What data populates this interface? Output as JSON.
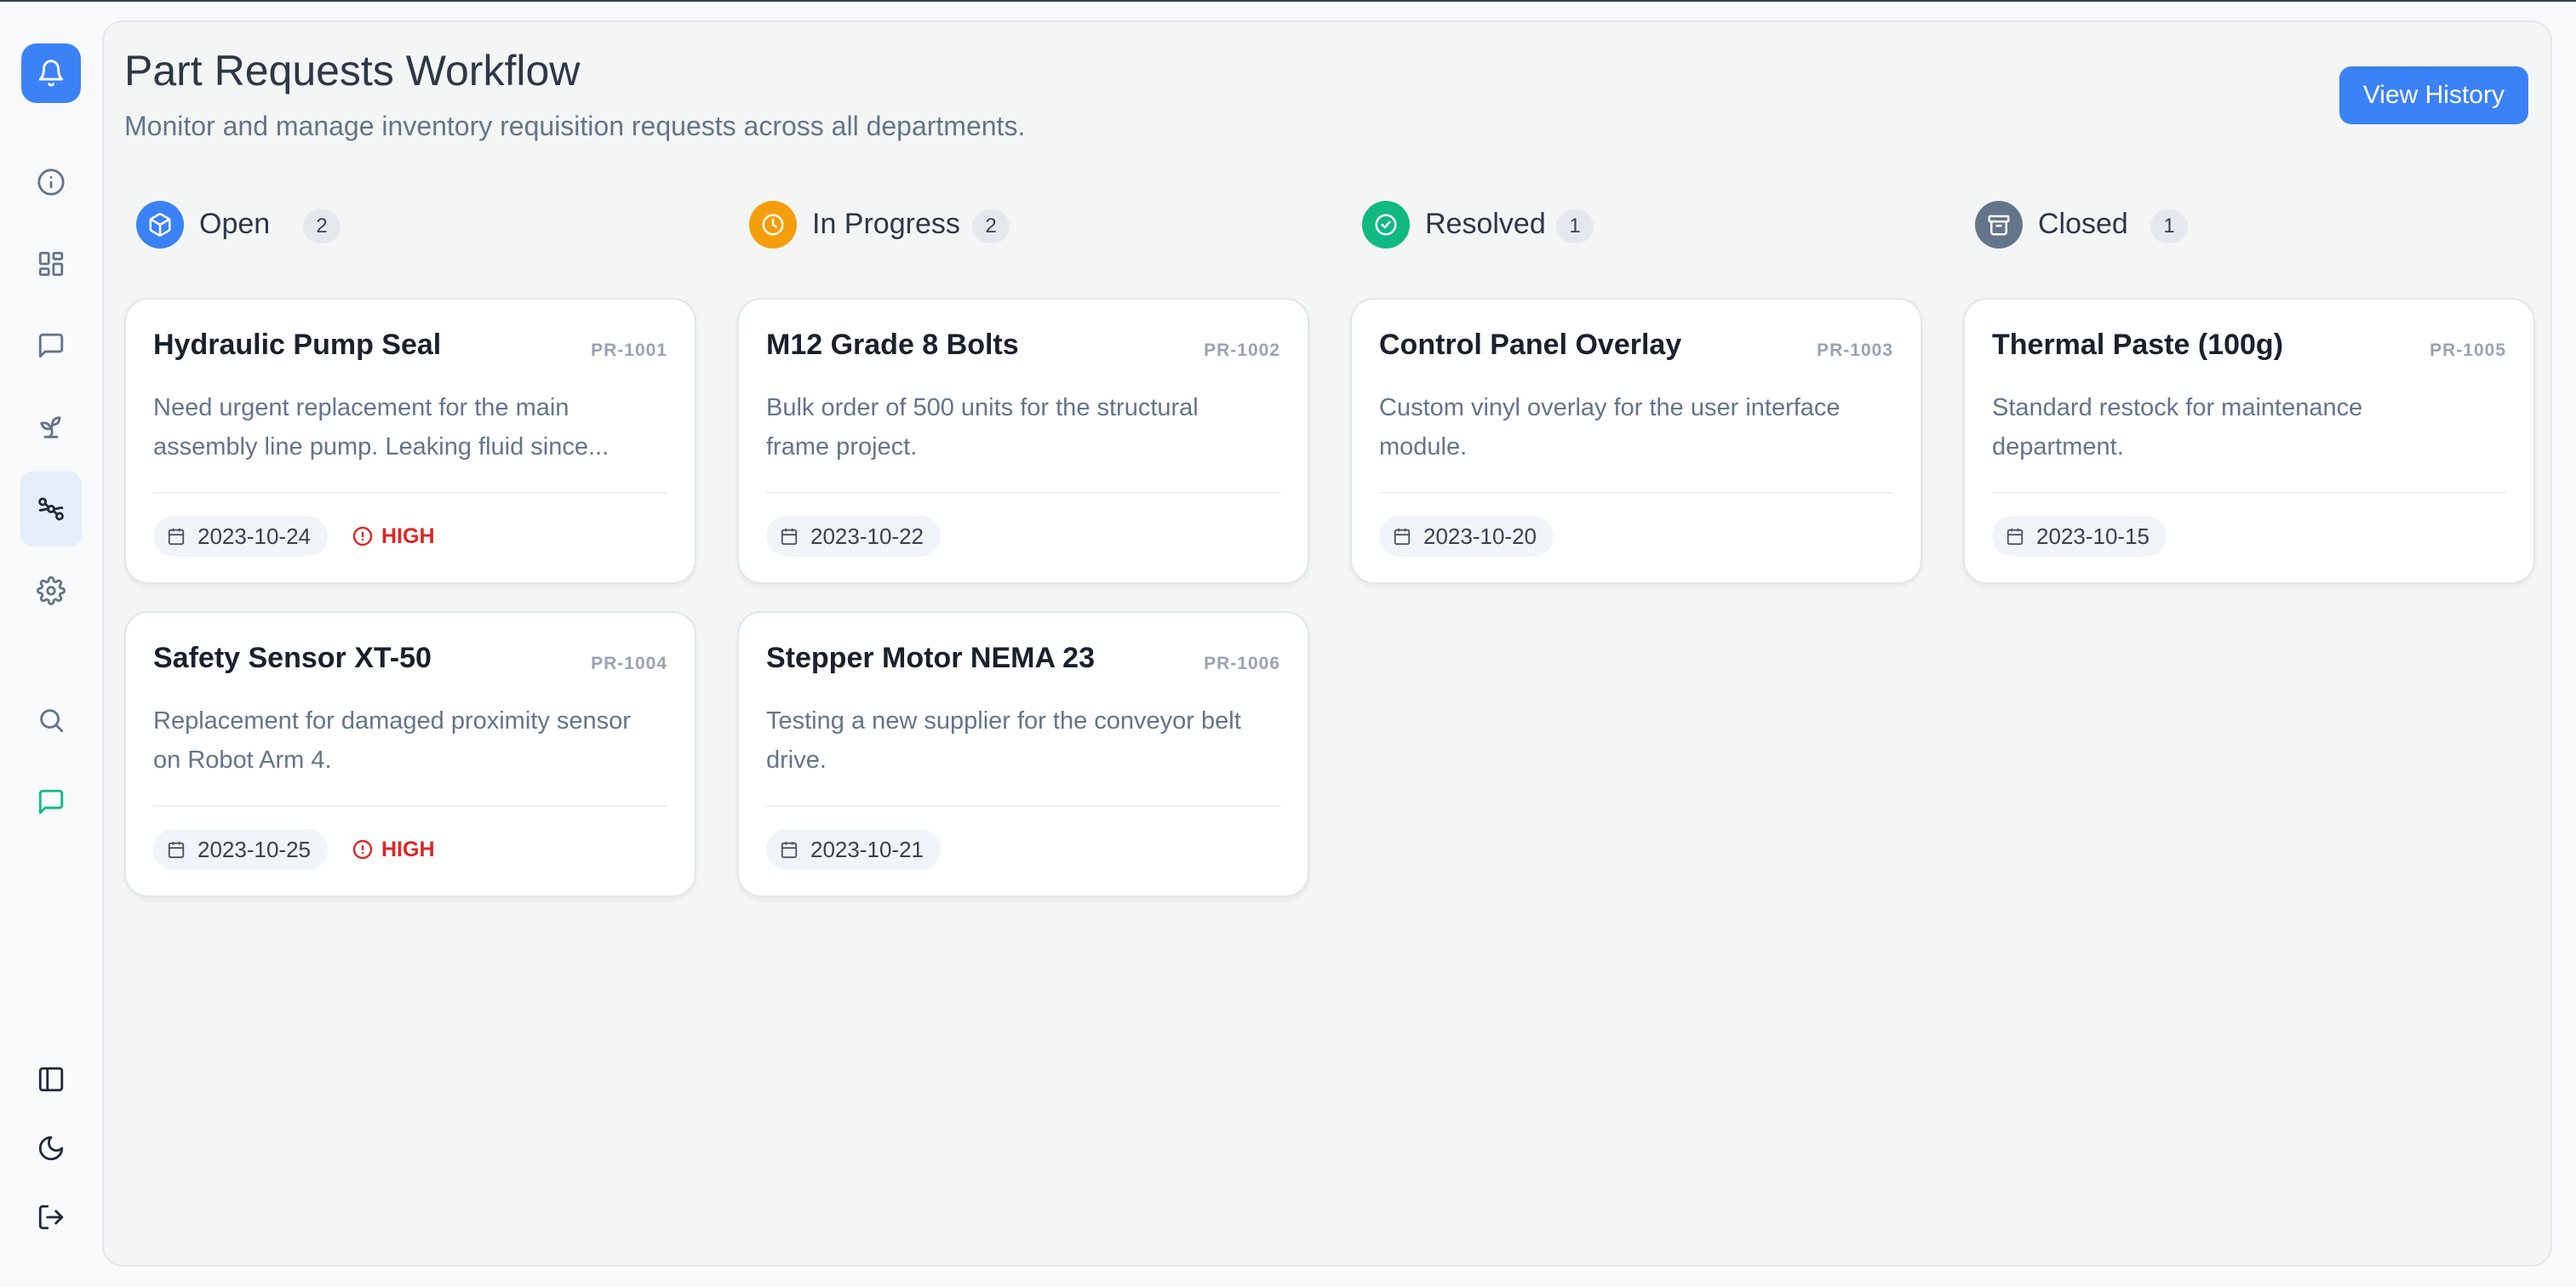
{
  "page": {
    "title": "Part Requests Workflow",
    "subtitle": "Monitor and manage inventory requisition requests across all departments.",
    "history_button": "View History"
  },
  "sidebar": {
    "items": [
      {
        "icon": "bell-icon",
        "active": true
      },
      {
        "icon": "info-icon"
      },
      {
        "icon": "dashboard-icon"
      },
      {
        "icon": "message-icon"
      },
      {
        "icon": "sprout-icon"
      },
      {
        "icon": "workflow-icon",
        "active": true
      },
      {
        "icon": "gear-icon"
      },
      {
        "icon": "search-icon"
      },
      {
        "icon": "chat-icon"
      },
      {
        "icon": "panel-toggle-icon"
      },
      {
        "icon": "moon-icon"
      },
      {
        "icon": "logout-icon"
      }
    ]
  },
  "colors": {
    "accent": "#3b82f6",
    "open": "#3b82f6",
    "in_progress": "#f59e0b",
    "resolved": "#10b981",
    "closed": "#64748b",
    "high_priority": "#dc2626"
  },
  "columns": [
    {
      "label": "Open",
      "count": "2",
      "icon": "box-icon",
      "cards": [
        {
          "title": "Hydraulic Pump Seal",
          "id": "PR-1001",
          "desc_line1": "Need urgent replacement for the main",
          "desc_line2": "assembly line pump. Leaking fluid since...",
          "date": "2023-10-24",
          "priority": "HIGH"
        },
        {
          "title": "Safety Sensor XT-50",
          "id": "PR-1004",
          "desc_line1": "Replacement for damaged proximity sensor",
          "desc_line2": "on Robot Arm 4.",
          "date": "2023-10-25",
          "priority": "HIGH"
        }
      ]
    },
    {
      "label": "In Progress",
      "count": "2",
      "icon": "clock-icon",
      "cards": [
        {
          "title": "M12 Grade 8 Bolts",
          "id": "PR-1002",
          "desc_line1": "Bulk order of 500 units for the structural",
          "desc_line2": "frame project.",
          "date": "2023-10-22"
        },
        {
          "title": "Stepper Motor NEMA 23",
          "id": "PR-1006",
          "desc_line1": "Testing a new supplier for the conveyor belt",
          "desc_line2": "drive.",
          "date": "2023-10-21"
        }
      ]
    },
    {
      "label": "Resolved",
      "count": "1",
      "icon": "check-circle-icon",
      "cards": [
        {
          "title": "Control Panel Overlay",
          "id": "PR-1003",
          "desc_line1": "Custom vinyl overlay for the user interface",
          "desc_line2": "module.",
          "date": "2023-10-20"
        }
      ]
    },
    {
      "label": "Closed",
      "count": "1",
      "icon": "archive-icon",
      "cards": [
        {
          "title": "Thermal Paste (100g)",
          "id": "PR-1005",
          "desc_line1": "Standard restock for maintenance",
          "desc_line2": "department.",
          "date": "2023-10-15"
        }
      ]
    }
  ]
}
